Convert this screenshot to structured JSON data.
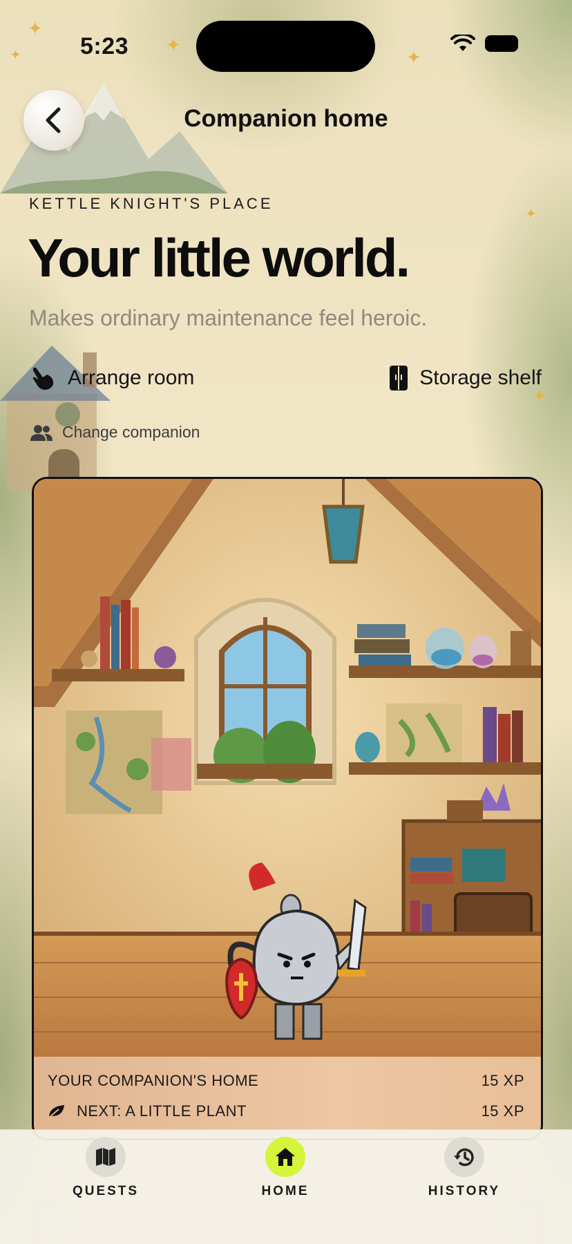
{
  "status_bar": {
    "time": "5:23"
  },
  "header": {
    "title": "Companion home",
    "back_icon": "chevron-left-icon"
  },
  "hero": {
    "eyebrow": "KETTLE KNIGHT'S PLACE",
    "title": "Your little world.",
    "subtitle": "Makes ordinary maintenance feel heroic."
  },
  "actions": {
    "arrange": {
      "label": "Arrange room",
      "icon": "hand-pointer-icon"
    },
    "storage": {
      "label": "Storage shelf",
      "icon": "cabinet-icon"
    },
    "change": {
      "label": "Change companion",
      "icon": "people-icon"
    }
  },
  "room": {
    "home_label": "YOUR COMPANION'S HOME",
    "home_xp": "15 XP",
    "next_label": "NEXT: A LITTLE PLANT",
    "next_xp": "15 XP",
    "next_icon": "leaf-icon"
  },
  "nav": {
    "items": [
      {
        "label": "QUESTS",
        "icon": "map-icon"
      },
      {
        "label": "HOME",
        "icon": "house-icon",
        "active": true
      },
      {
        "label": "HISTORY",
        "icon": "clock-history-icon"
      }
    ],
    "active_color": "#d4f53a"
  }
}
